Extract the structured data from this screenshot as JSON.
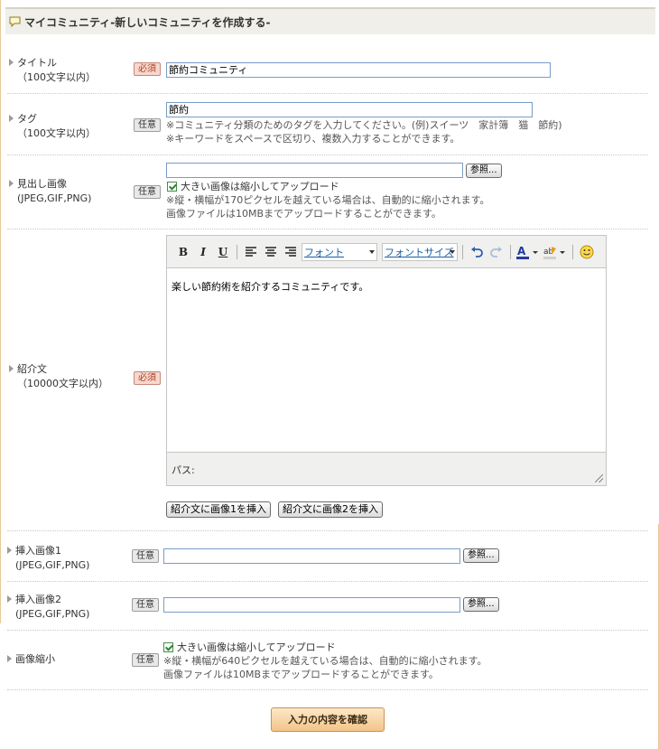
{
  "header": {
    "title": "マイコミュニティ-新しいコミュニティを作成する-"
  },
  "badges": {
    "required": "必須",
    "optional": "任意"
  },
  "browse_label": "参照...",
  "title_row": {
    "label": "タイトル",
    "sub": "（100文字以内）",
    "value": "節約コミュニティ"
  },
  "tag_row": {
    "label": "タグ",
    "sub": "（100文字以内）",
    "value": "節約",
    "note1": "※コミュニティ分類のためのタグを入力してください。(例)スイーツ　家計簿　猫　節約)",
    "note2": "※キーワードをスペースで区切り、複数入力することができます。"
  },
  "image_row": {
    "label": "見出し画像",
    "sub": "(JPEG,GIF,PNG)",
    "value": "",
    "check_label": "大きい画像は縮小してアップロード",
    "note1": "※縦・横幅が170ピクセルを越えている場合は、自動的に縮小されます。",
    "note2": "画像ファイルは10MBまでアップロードすることができます。"
  },
  "intro_row": {
    "label": "紹介文",
    "sub": "（10000文字以内）",
    "content": "楽しい節約術を紹介するコミュニティです。",
    "path_label": "パス:",
    "font_label": "フォント",
    "size_label": "フォントサイズ",
    "insert1": "紹介文に画像1を挿入",
    "insert2": "紹介文に画像2を挿入"
  },
  "insert_image1": {
    "label": "挿入画像1",
    "sub": "(JPEG,GIF,PNG)",
    "value": ""
  },
  "insert_image2": {
    "label": "挿入画像2",
    "sub": "(JPEG,GIF,PNG)",
    "value": ""
  },
  "shrink_row": {
    "label": "画像縮小",
    "check_label": "大きい画像は縮小してアップロード",
    "note1": "※縦・横幅が640ピクセルを越えている場合は、自動的に縮小されます。",
    "note2": "画像ファイルは10MBまでアップロードすることができます。"
  },
  "confirm_label": "入力の内容を確認"
}
